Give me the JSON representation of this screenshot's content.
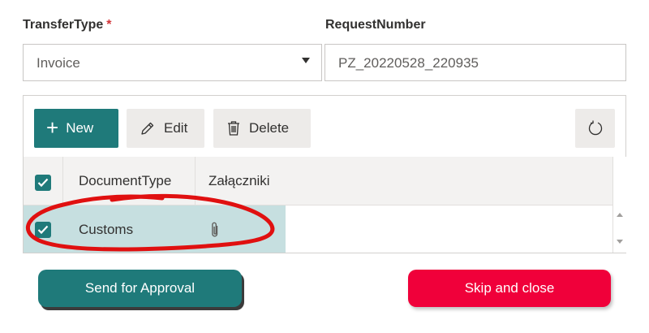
{
  "form": {
    "transfer_type_label": "TransferType",
    "required_marker": "*",
    "transfer_type_value": "Invoice",
    "request_number_label": "RequestNumber",
    "request_number_value": "PZ_20220528_220935"
  },
  "toolbar": {
    "new_label": "New",
    "edit_label": "Edit",
    "delete_label": "Delete",
    "icons": [
      "plus-icon",
      "pencil-icon",
      "trash-icon",
      "refresh-icon"
    ]
  },
  "grid": {
    "columns": [
      "DocumentType",
      "Załączniki"
    ],
    "rows": [
      {
        "document_type": "Customs",
        "attachment_icon": "paperclip-icon",
        "selected": true
      }
    ],
    "header_checked": true
  },
  "actions": {
    "send_label": "Send for Approval",
    "skip_label": "Skip and close"
  },
  "colors": {
    "accent": "#1f7a7a",
    "danger": "#f0003a",
    "selection": "#c6dfe0",
    "annotation": "#e01010"
  }
}
